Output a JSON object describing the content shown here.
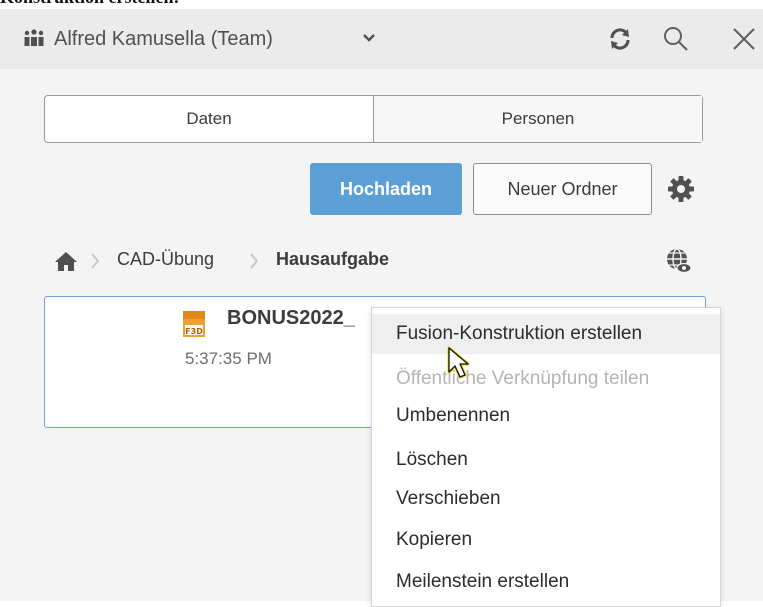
{
  "header": {
    "team_name": "Alfred Kamusella (Team)",
    "top_cropped_text": "Konstruktion erstellen:"
  },
  "tabs": [
    {
      "label": "Daten"
    },
    {
      "label": "Personen"
    }
  ],
  "actions": {
    "upload_label": "Hochladen",
    "new_folder_label": "Neuer Ordner"
  },
  "breadcrumb": {
    "items": [
      "CAD-Übung",
      "Hausaufgabe"
    ]
  },
  "file": {
    "name": "BONUS2022_",
    "icon_label": "F3D",
    "time": "5:37:35 PM"
  },
  "context_menu": {
    "items": [
      {
        "label": "Fusion-Konstruktion erstellen",
        "state": "hover"
      },
      {
        "label": "Öffentliche Verknüpfung teilen",
        "state": "disabled"
      },
      {
        "label": "Umbenennen",
        "state": "normal"
      },
      {
        "label": "Löschen",
        "state": "normal"
      },
      {
        "label": "Verschieben",
        "state": "normal"
      },
      {
        "label": "Kopieren",
        "state": "normal"
      },
      {
        "label": "Meilenstein erstellen",
        "state": "normal"
      }
    ]
  },
  "colors": {
    "accent": "#5c9fd6",
    "header_bg": "#ebebeb",
    "card_border": "#6e9fe0",
    "file_icon": "#f0a030"
  },
  "icons": [
    "team-icon",
    "chevron-down-icon",
    "refresh-icon",
    "search-icon",
    "close-icon",
    "gear-icon",
    "home-icon",
    "globe-icon",
    "f3d-file-icon",
    "mouse-cursor-icon"
  ]
}
